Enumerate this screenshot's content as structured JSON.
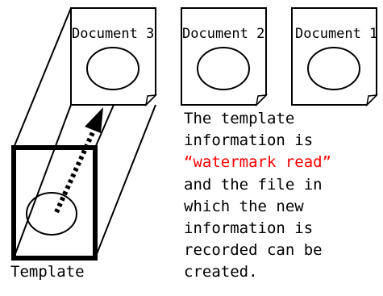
{
  "documents": [
    {
      "label": "Document 3"
    },
    {
      "label": "Document 2"
    },
    {
      "label": "Document 1"
    }
  ],
  "template": {
    "label": "Template"
  },
  "description": {
    "lines": [
      "The template",
      "information is",
      "“watermark read”",
      "and the file in",
      "which the new",
      "information is",
      "recorded can be",
      "created."
    ],
    "highlight_line_index": 2,
    "highlight_color": "#ff0000"
  }
}
